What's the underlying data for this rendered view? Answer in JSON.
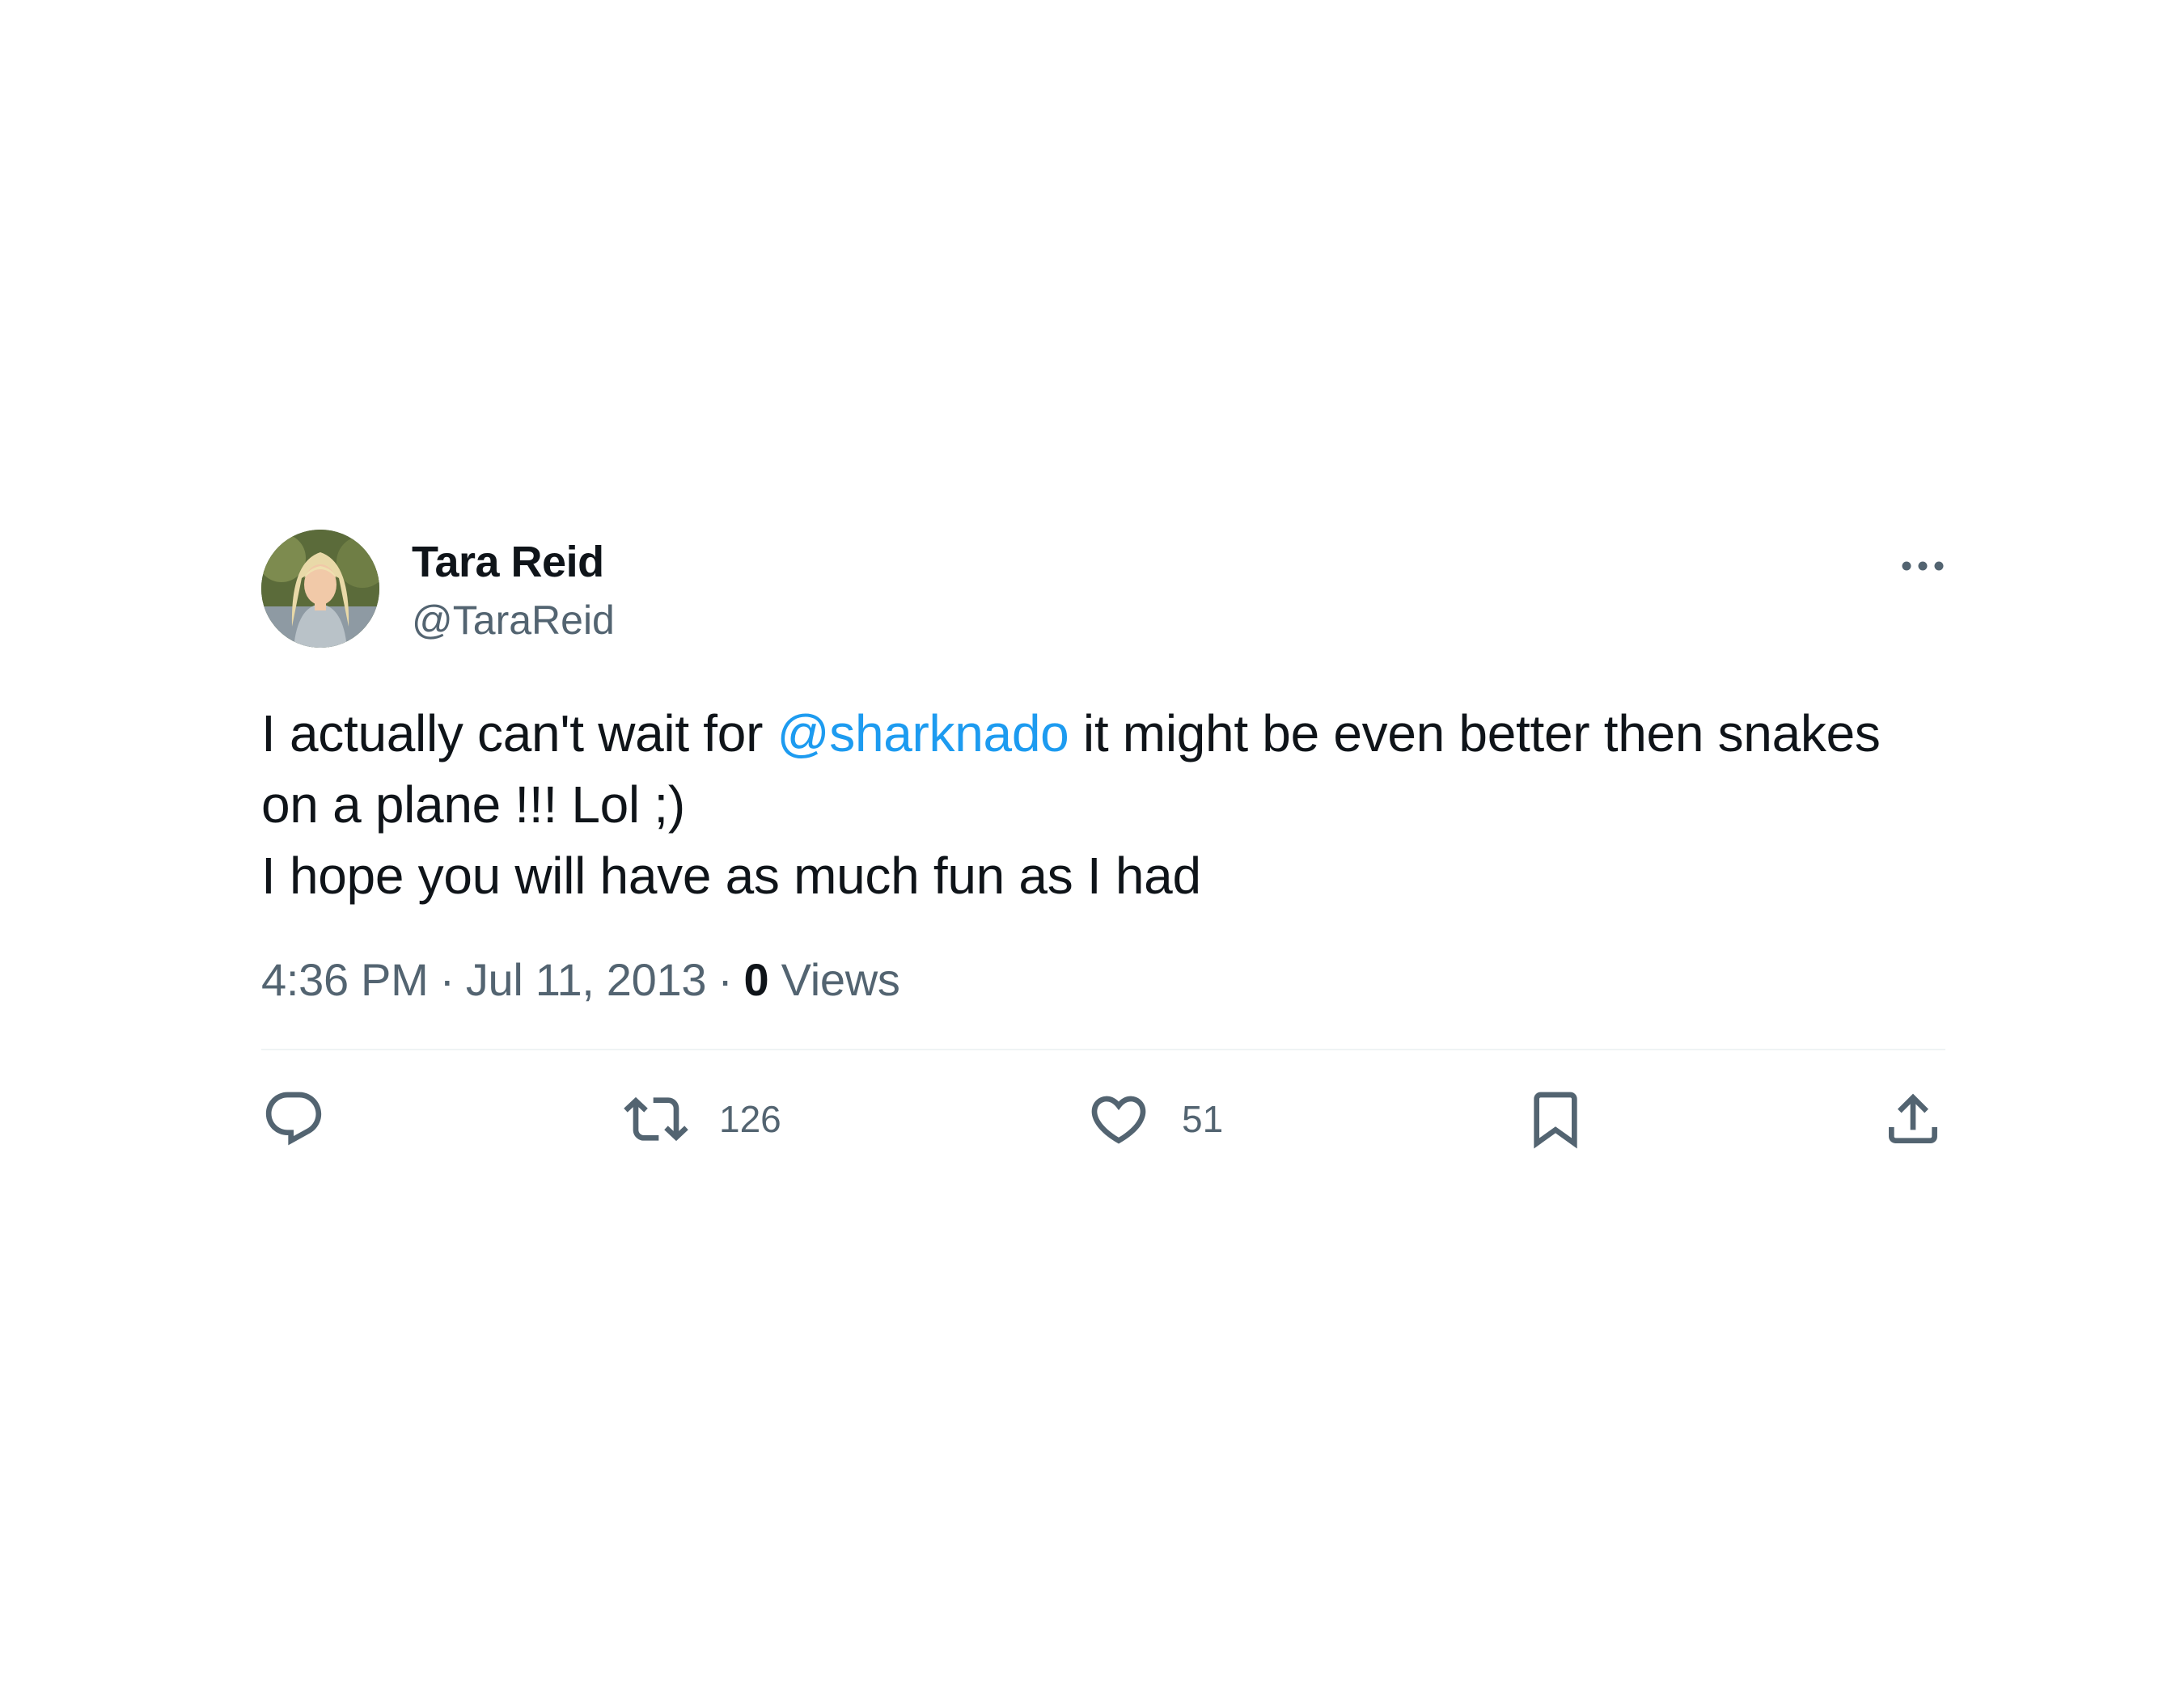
{
  "author": {
    "display_name": "Tara Reid",
    "handle": "@TaraReid",
    "avatar_icon": "avatar-photo"
  },
  "tweet": {
    "line1_before": "I actually can't wait for ",
    "mention": "@sharknado",
    "line1_after": " it might be even better then snakes",
    "line2": "on a plane !!! Lol ;)",
    "line3": "I hope you will have as much fun as I had"
  },
  "meta": {
    "time": "4:36 PM",
    "date": "Jul 11, 2013",
    "separator": "·",
    "views_count": "0",
    "views_label": "Views"
  },
  "actions": {
    "reply_icon": "reply-icon",
    "retweet_icon": "retweet-icon",
    "retweet_count": "126",
    "like_icon": "heart-icon",
    "like_count": "51",
    "bookmark_icon": "bookmark-icon",
    "share_icon": "share-icon"
  },
  "colors": {
    "text": "#0f1419",
    "secondary": "#536471",
    "link": "#1d9bf0",
    "divider": "#eff3f4"
  }
}
